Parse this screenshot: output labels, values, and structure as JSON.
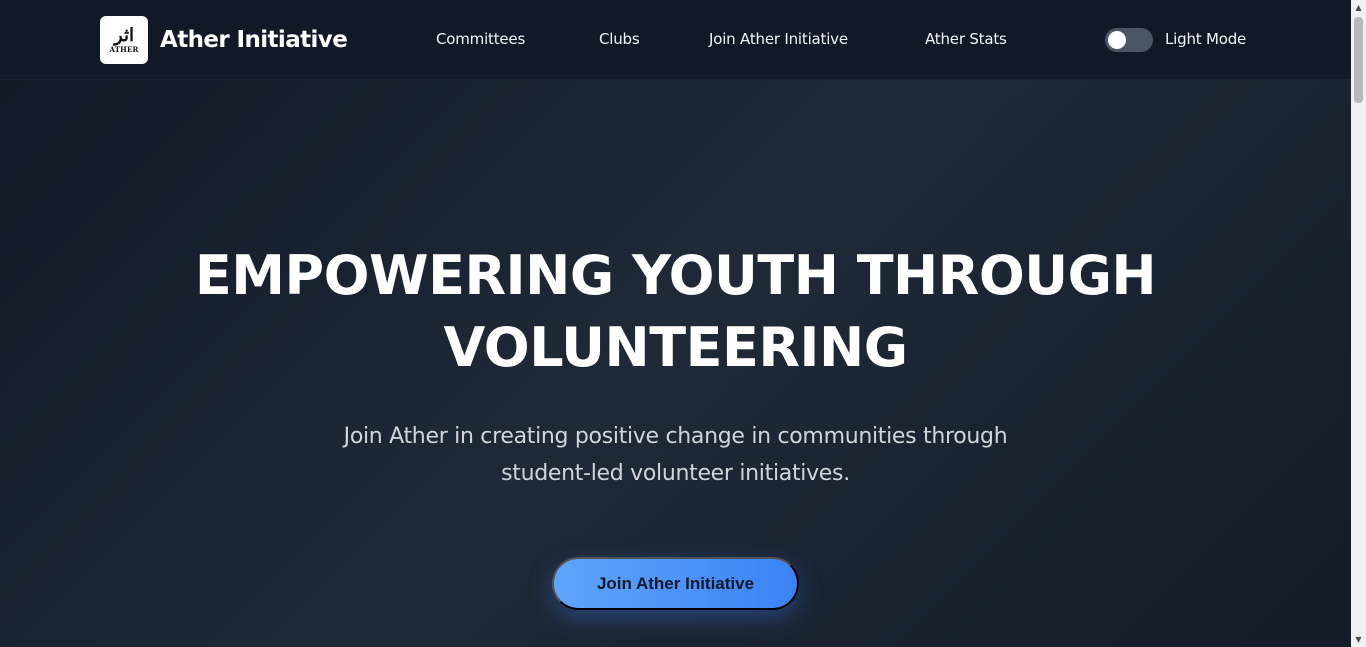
{
  "header": {
    "logo": {
      "glyph": "اثر",
      "word": "ATHER"
    },
    "brand_name": "Ather Initiative",
    "nav": [
      {
        "label": "Committees"
      },
      {
        "label": "Clubs"
      },
      {
        "label": "Join Ather Initiative"
      },
      {
        "label": "Ather Stats"
      }
    ],
    "theme_toggle": {
      "label": "Light Mode",
      "state": "off"
    }
  },
  "hero": {
    "title_lines": [
      "EMPOWERING YOUTH THROUGH",
      "VOLUNTEERING"
    ],
    "subtitle_lines": [
      "Join Ather in creating positive change in communities through",
      "student-led volunteer initiatives."
    ],
    "cta_label": "Join Ather Initiative"
  },
  "scrollbar": {
    "up_icon": "triangle-up",
    "down_icon": "triangle-down"
  },
  "colors": {
    "background": "#111827",
    "accent": "#3b82f6",
    "accent_light": "#60a5fa",
    "text": "#ffffff",
    "muted_text": "#d1d5db",
    "toggle_track": "#4b5563"
  }
}
